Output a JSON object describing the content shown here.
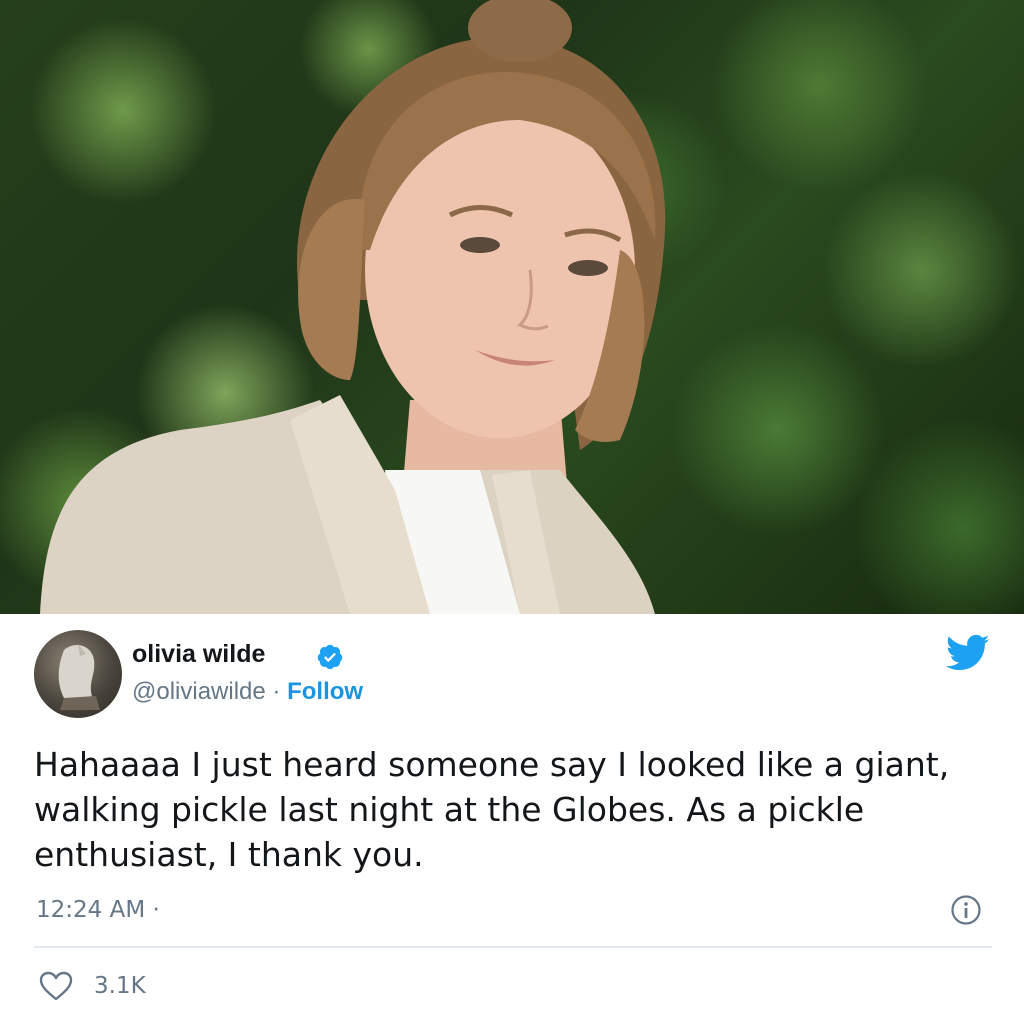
{
  "photo": {
    "icon": "portrait-photo"
  },
  "tweet": {
    "display_name": "olivia wilde",
    "handle": "@oliviawilde",
    "separator": "·",
    "follow_label": "Follow",
    "text": "Hahaaaa I just heard someone say I looked like a giant, walking pickle last night at the Globes. As a pickle enthusiast, I thank you.",
    "timestamp": "12:24 AM ·",
    "like_count": "3.1K"
  },
  "colors": {
    "link_blue": "#1b95e0",
    "twitter_blue": "#1da1f2",
    "text_dark": "#14171a",
    "text_gray": "#657786"
  },
  "icons": {
    "verified": "verified-badge-icon",
    "logo": "twitter-bird-icon",
    "info": "info-icon",
    "like": "heart-icon"
  }
}
